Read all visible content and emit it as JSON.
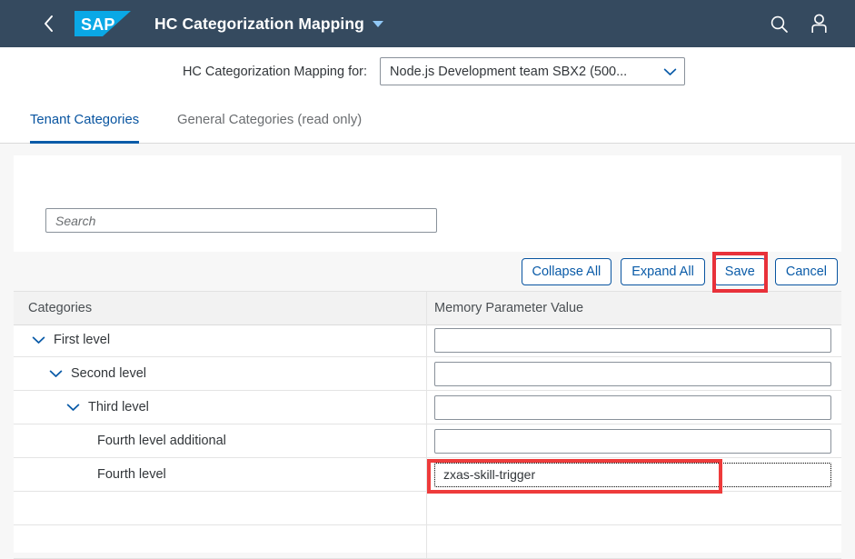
{
  "shell": {
    "back_icon": "chevron-left-icon",
    "logo_text": "SAP",
    "title": "HC Categorization Mapping",
    "title_caret_icon": "caret-down-icon",
    "search_icon": "search-icon",
    "user_icon": "person-icon",
    "bar_color": "#354a5f",
    "logo_color": "#0aa8e6"
  },
  "selector": {
    "label": "HC Categorization Mapping for:",
    "value": "Node.js Development team SBX2 (500...",
    "chevron_icon": "chevron-down-icon"
  },
  "tabs": [
    {
      "label": "Tenant Categories",
      "active": true
    },
    {
      "label": "General Categories (read only)",
      "active": false
    }
  ],
  "search": {
    "value": "",
    "placeholder": "Search"
  },
  "toolbar": {
    "buttons": [
      {
        "label": "Collapse All",
        "highlighted": false
      },
      {
        "label": "Expand All",
        "highlighted": false
      },
      {
        "label": "Save",
        "highlighted": true
      },
      {
        "label": "Cancel",
        "highlighted": false
      }
    ],
    "accent_color": "#0854a0",
    "annotation_color": "#e8313a"
  },
  "table": {
    "headers": [
      "Categories",
      "Memory Parameter Value"
    ],
    "rows": [
      {
        "label": "First level",
        "indent": 0,
        "expandable": true,
        "value": "",
        "focused": false,
        "annotated": false
      },
      {
        "label": "Second level",
        "indent": 1,
        "expandable": true,
        "value": "",
        "focused": false,
        "annotated": false
      },
      {
        "label": "Third level",
        "indent": 2,
        "expandable": true,
        "value": "",
        "focused": false,
        "annotated": false
      },
      {
        "label": "Fourth level additional",
        "indent": 3,
        "expandable": false,
        "value": "",
        "focused": false,
        "annotated": false
      },
      {
        "label": "Fourth level",
        "indent": 3,
        "expandable": false,
        "value": "zxas-skill-trigger",
        "focused": true,
        "annotated": true
      },
      {
        "label": "",
        "indent": 0,
        "expandable": false,
        "value": null,
        "focused": false,
        "annotated": false
      },
      {
        "label": "",
        "indent": 0,
        "expandable": false,
        "value": null,
        "focused": false,
        "annotated": false
      }
    ],
    "chevron_icon": "chevron-down-icon"
  }
}
